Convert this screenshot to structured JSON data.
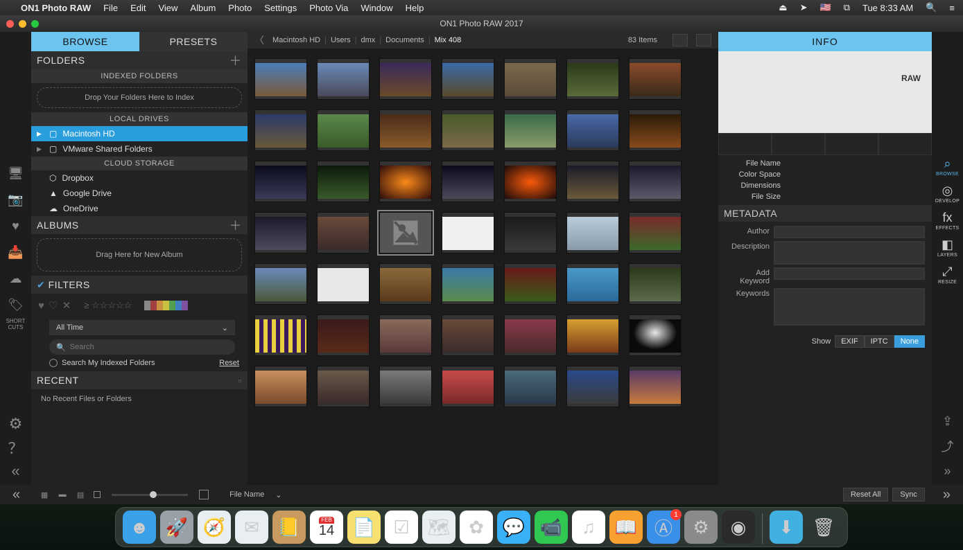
{
  "menubar": {
    "app": "ON1 Photo RAW",
    "items": [
      "File",
      "Edit",
      "View",
      "Album",
      "Photo",
      "Settings",
      "Photo Via",
      "Window",
      "Help"
    ],
    "clock": "Tue 8:33 AM"
  },
  "window_title": "ON1 Photo RAW 2017",
  "tabs": {
    "browse": "BROWSE",
    "presets": "PRESETS"
  },
  "folders": {
    "title": "FOLDERS",
    "indexed_hdr": "INDEXED FOLDERS",
    "drop_hint": "Drop Your Folders Here to Index",
    "local_hdr": "LOCAL DRIVES",
    "drives": [
      {
        "name": "Macintosh HD",
        "selected": true
      },
      {
        "name": "VMware Shared Folders",
        "selected": false
      }
    ],
    "cloud_hdr": "CLOUD STORAGE",
    "clouds": [
      "Dropbox",
      "Google Drive",
      "OneDrive"
    ]
  },
  "albums": {
    "title": "ALBUMS",
    "drop_hint": "Drag Here for New Album"
  },
  "filters": {
    "title": "FILTERS",
    "time_range": "All Time",
    "search_placeholder": "Search",
    "search_indexed": "Search My Indexed Folders",
    "reset": "Reset",
    "swatch_colors": [
      "#888",
      "#a04040",
      "#c89040",
      "#c8c040",
      "#50a050",
      "#4080c0",
      "#8050a0"
    ]
  },
  "recent": {
    "title": "RECENT",
    "empty": "No Recent Files or Folders"
  },
  "breadcrumb": {
    "parts": [
      "Macintosh HD",
      "Users",
      "dmx",
      "Documents",
      "Mix 408"
    ],
    "count": "83 Items"
  },
  "info": {
    "title": "INFO",
    "badge": "RAW",
    "rows": [
      "File Name",
      "Color Space",
      "Dimensions",
      "File Size"
    ]
  },
  "metadata": {
    "title": "METADATA",
    "fields": {
      "author": "Author",
      "description": "Description",
      "add_keyword": "Add Keyword",
      "keywords": "Keywords"
    },
    "show_label": "Show",
    "show_opts": [
      "EXIF",
      "IPTC",
      "None"
    ],
    "show_active": "None"
  },
  "right_tools": [
    {
      "id": "browse",
      "label": "BROWSE",
      "glyph": "⌕",
      "active": true
    },
    {
      "id": "develop",
      "label": "DEVELOP",
      "glyph": "◎",
      "active": false
    },
    {
      "id": "effects",
      "label": "EFFECTS",
      "glyph": "fx",
      "active": false
    },
    {
      "id": "layers",
      "label": "LAYERS",
      "glyph": "◧",
      "active": false
    },
    {
      "id": "resize",
      "label": "RESIZE",
      "glyph": "⤢",
      "active": false
    }
  ],
  "bottom": {
    "sort": "File Name",
    "reset_all": "Reset All",
    "sync": "Sync"
  },
  "shortcuts_label": "SHORT\nCUTS",
  "dock": {
    "apps": [
      {
        "id": "finder",
        "bg": "#3aa0e8",
        "glyph": "☻"
      },
      {
        "id": "launchpad",
        "bg": "#9aa0a8",
        "glyph": "🚀"
      },
      {
        "id": "safari",
        "bg": "#e8eef2",
        "glyph": "🧭"
      },
      {
        "id": "mail",
        "bg": "#e8eef2",
        "glyph": "✉"
      },
      {
        "id": "contacts",
        "bg": "#c89a60",
        "glyph": "📒"
      },
      {
        "id": "calendar",
        "bg": "#fff",
        "glyph": "14",
        "text": true,
        "top": "FEB"
      },
      {
        "id": "notes",
        "bg": "#f8e070",
        "glyph": "📄"
      },
      {
        "id": "reminders",
        "bg": "#fff",
        "glyph": "☑"
      },
      {
        "id": "maps",
        "bg": "#e8eef2",
        "glyph": "🗺"
      },
      {
        "id": "photos",
        "bg": "#fff",
        "glyph": "✿"
      },
      {
        "id": "messages",
        "bg": "#3ab0f8",
        "glyph": "💬"
      },
      {
        "id": "facetime",
        "bg": "#30c850",
        "glyph": "📹"
      },
      {
        "id": "itunes",
        "bg": "#fff",
        "glyph": "♫"
      },
      {
        "id": "ibooks",
        "bg": "#f8a030",
        "glyph": "📖"
      },
      {
        "id": "appstore",
        "bg": "#3a90e8",
        "glyph": "Ⓐ",
        "badge": "1"
      },
      {
        "id": "sysprefs",
        "bg": "#8a8a8a",
        "glyph": "⚙"
      },
      {
        "id": "on1",
        "bg": "#2a2a2a",
        "glyph": "◉"
      }
    ],
    "right": [
      {
        "id": "downloads",
        "bg": "#40b0e0",
        "glyph": "⬇"
      },
      {
        "id": "trash",
        "bg": "transparent",
        "glyph": "🗑"
      }
    ]
  }
}
